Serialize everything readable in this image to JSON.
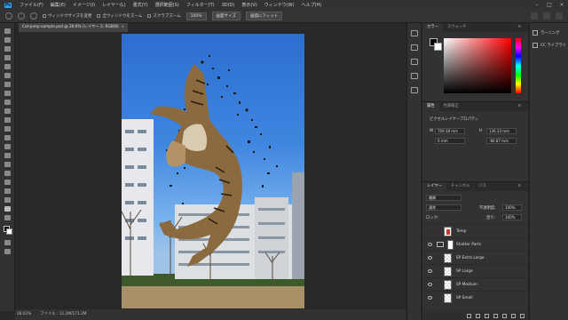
{
  "menubar": {
    "logo": "Ps",
    "items": [
      "ファイル(F)",
      "編集(E)",
      "イメージ(I)",
      "レイヤー(L)",
      "書式(Y)",
      "選択範囲(S)",
      "フィルター(T)",
      "3D(D)",
      "表示(V)",
      "ウィンドウ(W)",
      "ヘルプ(H)"
    ],
    "window_controls": [
      "minimize-icon",
      "maximize-icon",
      "close-icon"
    ]
  },
  "options": {
    "resize_windows": "ウィンドウサイズを変更",
    "all_windows": "全ウィンドウをズーム",
    "scrubby_zoom": "スクラブズーム",
    "zoom_100": "100%",
    "fit_screen": "画面サイズ",
    "fill_screen": "画面にフィット"
  },
  "document": {
    "tab_title": "Cat-jump-sample.psd @ 28.6% (レイヤー 2, RGB/8)",
    "tab_close": "×",
    "zoom": "28.61%",
    "file_info": "ファイル : 11.2M/171.2M"
  },
  "color_panel": {
    "tabs": [
      "カラー",
      "スウォッチ"
    ],
    "fg_color": "#000000",
    "bg_color": "#ffffff"
  },
  "properties_panel": {
    "tabs": [
      "属性",
      "色調補正"
    ],
    "layer_kind": "ピクセルレイヤープロパティ",
    "w": "W",
    "w_value": "709.38 mm",
    "h": "H",
    "h_value": "136.33 mm",
    "x_value": "0 mm",
    "y_value": "-84.87 mm"
  },
  "layers_panel": {
    "tabs": [
      "レイヤー",
      "チャンネル",
      "パス"
    ],
    "kind_filter": "種類",
    "blend_mode": "通常",
    "opacity_label": "不透明度:",
    "opacity_value": "100%",
    "lock_label": "ロック:",
    "fill_label": "塗り:",
    "fill_value": "100%",
    "layers": [
      {
        "name": "Temp",
        "type": "pixel"
      },
      {
        "name": "Shatter Parts",
        "type": "group"
      },
      {
        "name": "SP Extra Large",
        "type": "pixel"
      },
      {
        "name": "SP Large",
        "type": "pixel"
      },
      {
        "name": "SP Medium",
        "type": "pixel"
      },
      {
        "name": "SP Small",
        "type": "pixel"
      }
    ]
  },
  "far_panel": {
    "items": [
      "ラーニング",
      "CC ライブラリ"
    ]
  }
}
